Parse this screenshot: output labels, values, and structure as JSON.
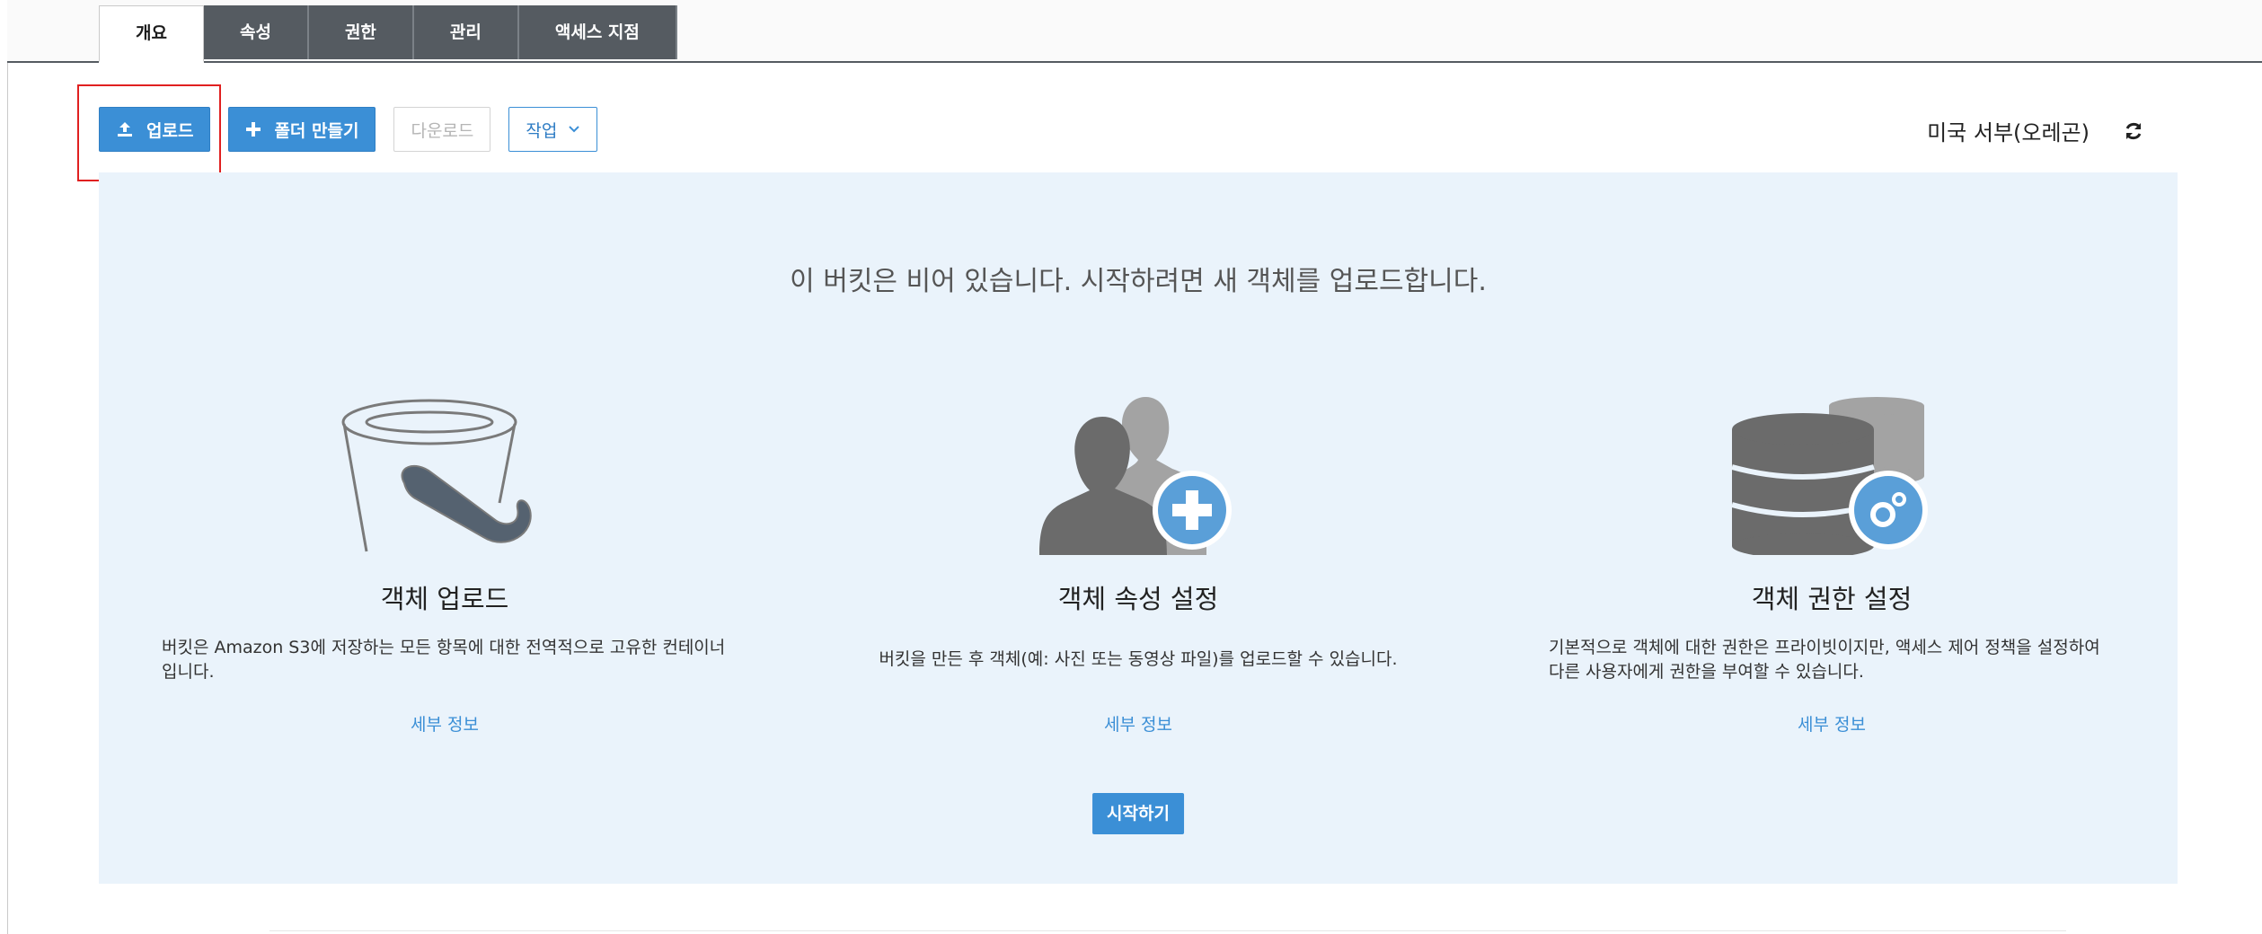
{
  "tabs": [
    {
      "label": "개요",
      "active": true
    },
    {
      "label": "속성",
      "active": false
    },
    {
      "label": "권한",
      "active": false
    },
    {
      "label": "관리",
      "active": false
    },
    {
      "label": "액세스 지점",
      "active": false
    }
  ],
  "toolbar": {
    "upload_label": "업로드",
    "create_folder_label": "폴더 만들기",
    "download_label": "다운로드",
    "actions_label": "작업",
    "icons": {
      "upload": "upload-icon",
      "create_folder": "plus-icon",
      "actions": "chevron-down-icon"
    }
  },
  "region": {
    "label": "미국 서부(오레곤)",
    "refresh_icon": "refresh-icon"
  },
  "empty_state": {
    "message": "이 버킷은 비어 있습니다. 시작하려면 새 객체를 업로드합니다.",
    "cards": [
      {
        "title": "객체 업로드",
        "description": "버킷은 Amazon S3에 저장하는 모든 항목에 대한 전역적으로 고유한 컨테이너입니다.",
        "link": "세부 정보",
        "icon": "bucket-icon"
      },
      {
        "title": "객체 속성 설정",
        "description": "버킷을 만든 후 객체(예: 사진 또는 동영상 파일)를 업로드할 수 있습니다.",
        "link": "세부 정보",
        "icon": "users-add-icon"
      },
      {
        "title": "객체 권한 설정",
        "description": "기본적으로 객체에 대한 권한은 프라이빗이지만, 액세스 제어 정책을 설정하여 다른 사용자에게 권한을 부여할 수 있습니다.",
        "link": "세부 정보",
        "icon": "database-settings-icon"
      }
    ],
    "start_label": "시작하기"
  },
  "colors": {
    "primary": "#3b8fd6",
    "tab_dark": "#555b61",
    "panel_bg": "#eaf3fb",
    "highlight": "#e02020",
    "icon_gray": "#6b6b6b",
    "icon_blue": "#5a9fd8"
  }
}
